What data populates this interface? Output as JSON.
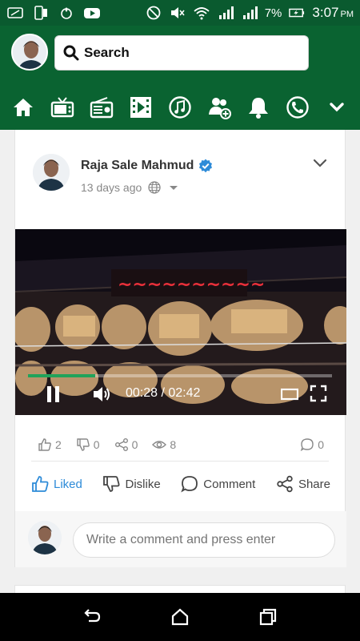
{
  "status_bar": {
    "battery": "7%",
    "time": "3:07",
    "ampm": "PM",
    "icons": [
      "screenshot-icon",
      "phone-icon",
      "location-icon",
      "youtube-icon",
      "dnd-icon",
      "mute-icon",
      "wifi-icon",
      "signal-icon",
      "signal-icon",
      "battery-icon"
    ]
  },
  "header": {
    "search_label": "Search",
    "nav_icons": [
      "home-icon",
      "tv-icon",
      "radio-icon",
      "video-icon",
      "music-icon",
      "friends-icon",
      "notifications-icon",
      "call-icon",
      "more-icon"
    ]
  },
  "post": {
    "author": "Raja Sale Mahmud",
    "time_ago": "13 days ago",
    "video": {
      "current": "00:28",
      "duration": "02:42",
      "time_display": "00:28 / 02:42",
      "progress": 0.22
    },
    "stats": {
      "likes": "2",
      "dislikes": "0",
      "shares": "0",
      "views": "8",
      "comments": "0"
    },
    "actions": {
      "like": "Liked",
      "dislike": "Dislike",
      "comment": "Comment",
      "share": "Share"
    },
    "comment_placeholder": "Write a comment and press enter"
  },
  "colors": {
    "header": "#0a6331",
    "status_bar": "#0a5a2f",
    "liked": "#2d8bd8"
  }
}
